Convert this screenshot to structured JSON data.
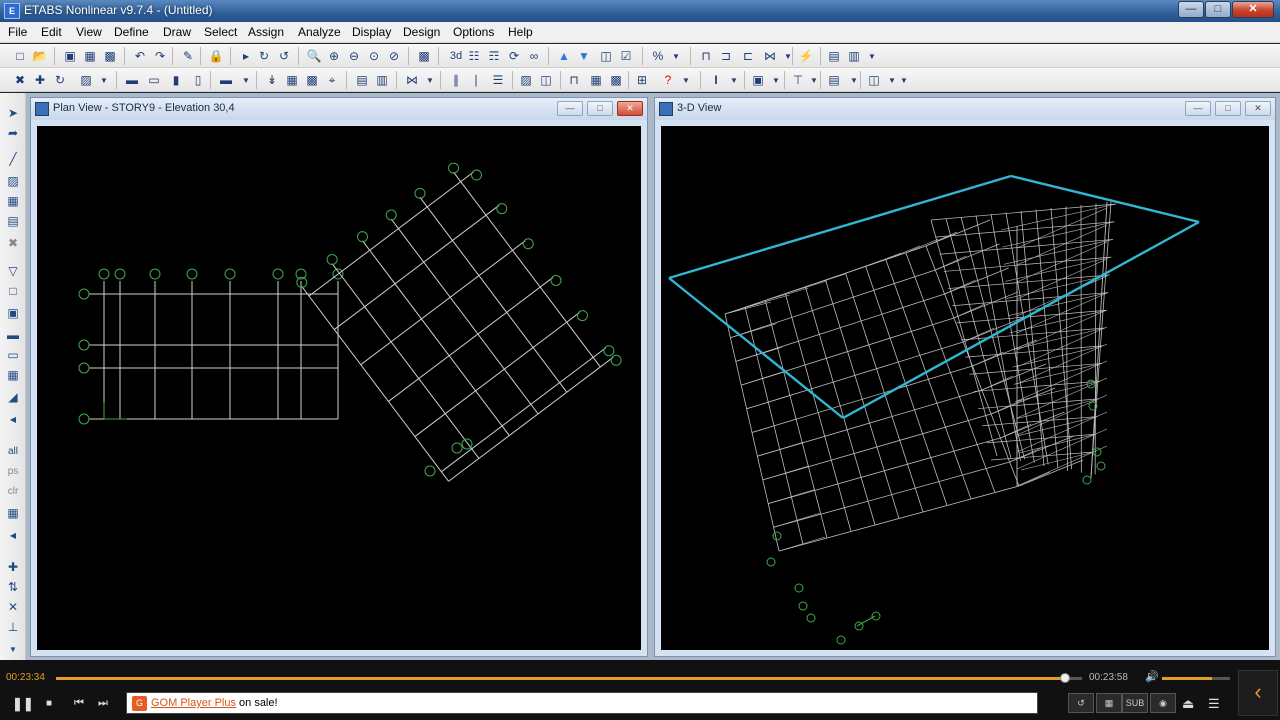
{
  "window": {
    "title": "ETABS Nonlinear v9.7.4 - (Untitled)",
    "icon_text": "E"
  },
  "menu": [
    {
      "label": "File"
    },
    {
      "label": "Edit"
    },
    {
      "label": "View"
    },
    {
      "label": "Define"
    },
    {
      "label": "Draw"
    },
    {
      "label": "Select"
    },
    {
      "label": "Assign"
    },
    {
      "label": "Analyze"
    },
    {
      "label": "Display"
    },
    {
      "label": "Design"
    },
    {
      "label": "Options"
    },
    {
      "label": "Help"
    }
  ],
  "toolbar": {
    "view_3d_label": "3d"
  },
  "plan_view": {
    "title": "Plan View - STORY9 - Elevation 30,4"
  },
  "view_3d": {
    "title": "3-D View"
  },
  "player": {
    "elapsed": "00:23:34",
    "total": "00:23:58",
    "progress": 0.983,
    "volume": 0.74,
    "message_link": "GOM Player Plus",
    "message_rest": " on sale!",
    "sub_label": "SUB",
    "icon_text": "G"
  },
  "colors": {
    "accent": "#e39b2a",
    "slab_outline": "#2fb7d4",
    "grid_lines": "#cfcfcf",
    "grid_bubbles": "#3fa84a"
  }
}
